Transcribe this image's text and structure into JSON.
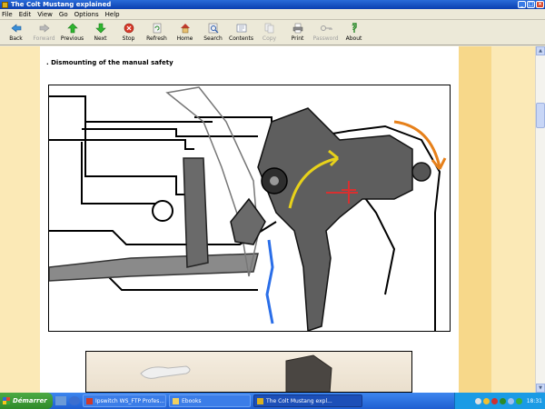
{
  "window": {
    "title": "The Colt Mustang explained"
  },
  "menu": [
    "File",
    "Edit",
    "View",
    "Go",
    "Options",
    "Help"
  ],
  "toolbar": [
    {
      "label": "Back",
      "icon": "back-arrow-icon",
      "enabled": true
    },
    {
      "label": "Forward",
      "icon": "forward-arrow-icon",
      "enabled": false
    },
    {
      "label": "Previous",
      "icon": "up-arrow-icon",
      "enabled": true
    },
    {
      "label": "Next",
      "icon": "down-arrow-icon",
      "enabled": true
    },
    {
      "label": "Stop",
      "icon": "stop-icon",
      "enabled": true
    },
    {
      "label": "Refresh",
      "icon": "refresh-icon",
      "enabled": true
    },
    {
      "label": "Home",
      "icon": "home-icon",
      "enabled": true
    },
    {
      "label": "Search",
      "icon": "search-icon",
      "enabled": true
    },
    {
      "label": "Contents",
      "icon": "contents-icon",
      "enabled": true
    },
    {
      "label": "Copy",
      "icon": "copy-icon",
      "enabled": false
    },
    {
      "label": "Print",
      "icon": "print-icon",
      "enabled": true
    },
    {
      "label": "Password",
      "icon": "key-icon",
      "enabled": false
    },
    {
      "label": "About",
      "icon": "about-icon",
      "enabled": true
    }
  ],
  "content": {
    "heading": ". Dismounting of the manual safety"
  },
  "taskbar": {
    "start_label": "Démarrer",
    "tasks": [
      {
        "label": "Ipswitch WS_FTP Profes...",
        "active": false
      },
      {
        "label": "Ebooks",
        "active": false
      },
      {
        "label": "The Colt Mustang expl...",
        "active": true
      }
    ],
    "clock": "18:31"
  },
  "colors": {
    "accent_yellow": "#f7d88a",
    "page_background": "#fbe9b6",
    "arrow_yellow": "#e8d21a",
    "arrow_orange": "#e6801a",
    "cross_red": "#d83030",
    "spring_blue": "#2a6ee8"
  }
}
